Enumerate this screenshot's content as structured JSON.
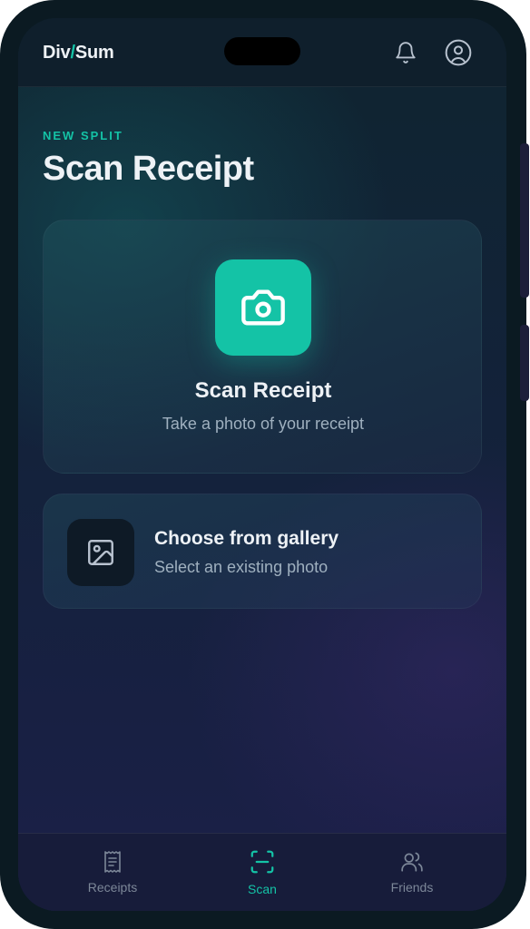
{
  "app": {
    "logo_left": "Div",
    "logo_slash": "/",
    "logo_right": "Sum"
  },
  "header": {
    "eyebrow": "NEW SPLIT",
    "title": "Scan Receipt"
  },
  "scan_card": {
    "title": "Scan Receipt",
    "subtitle": "Take a photo of your receipt"
  },
  "gallery_card": {
    "title": "Choose from gallery",
    "subtitle": "Select an existing photo"
  },
  "tabs": [
    {
      "label": "Receipts",
      "icon": "receipt-icon",
      "active": false
    },
    {
      "label": "Scan",
      "icon": "scan-icon",
      "active": true
    },
    {
      "label": "Friends",
      "icon": "friends-icon",
      "active": false
    }
  ],
  "colors": {
    "accent": "#14c3a6",
    "text_primary": "#eef2f6",
    "text_secondary": "#9fb0bf",
    "tab_inactive": "#7c8798"
  }
}
